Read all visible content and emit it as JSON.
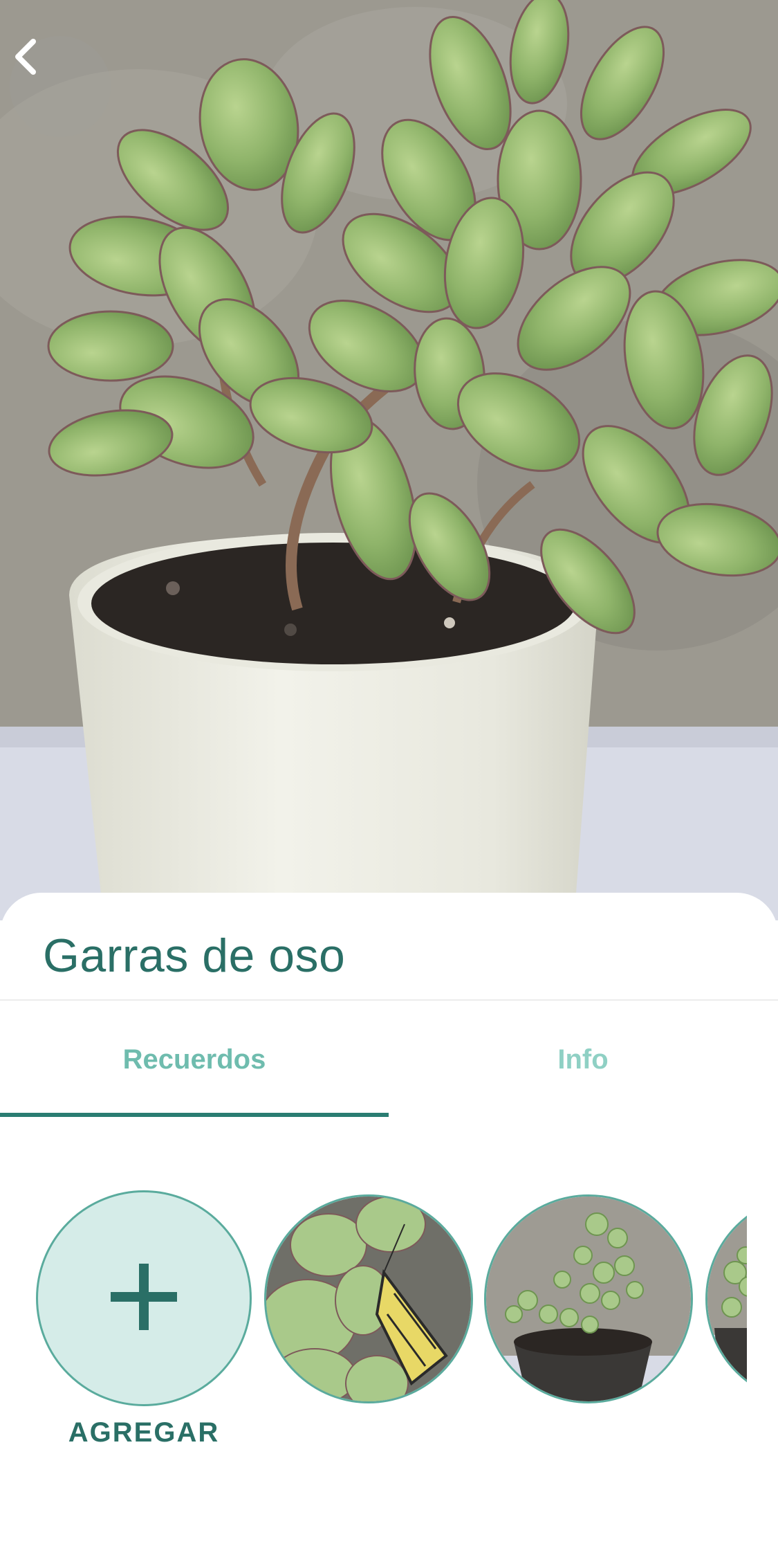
{
  "header": {
    "back_icon": "chevron-left-icon",
    "photo_alt": "Garras de oso"
  },
  "plant": {
    "name": "Garras de oso"
  },
  "tabs": [
    {
      "label": "Recuerdos",
      "active": true
    },
    {
      "label": "Info",
      "active": false
    }
  ],
  "memories": {
    "add_label": "AGREGAR",
    "add_icon": "plus-icon",
    "photo_count_visible": 3
  },
  "colors": {
    "accent": "#2a7d72",
    "title": "#2a6f66",
    "tab_active": "#6fbcae",
    "tab_inactive": "#8fd0c4",
    "add_fill": "#d5ece8"
  }
}
